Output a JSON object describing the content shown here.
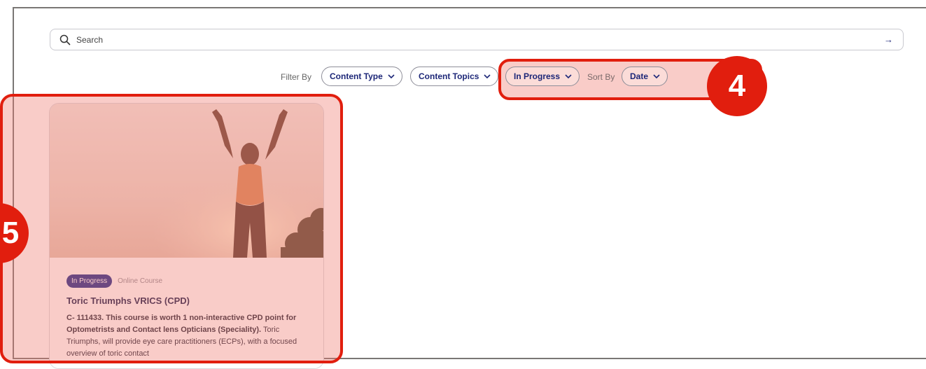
{
  "search": {
    "placeholder": "Search",
    "submit_icon": "arrow-right-icon"
  },
  "filters": {
    "filter_label": "Filter By",
    "content_type": "Content Type",
    "content_topics": "Content Topics",
    "status": "In Progress",
    "sort_label": "Sort By",
    "sort": "Date"
  },
  "annotations": {
    "badge_4": "4",
    "badge_5": "5",
    "highlight_color": "#e11e0e"
  },
  "card": {
    "status_tag": "In Progress",
    "type_tag": "Online Course",
    "title": "Toric Triumphs VRICS (CPD)",
    "desc_bold": "C- 111433. This course is worth 1 non-interactive CPD point for Optometrists and Contact lens Opticians (Speciality).",
    "desc_rest": " Toric Triumphs, will provide eye care practitioners (ECPs), with a focused overview of toric contact"
  },
  "colors": {
    "brand": "#1d2778",
    "accent": "#1d2a8c"
  }
}
